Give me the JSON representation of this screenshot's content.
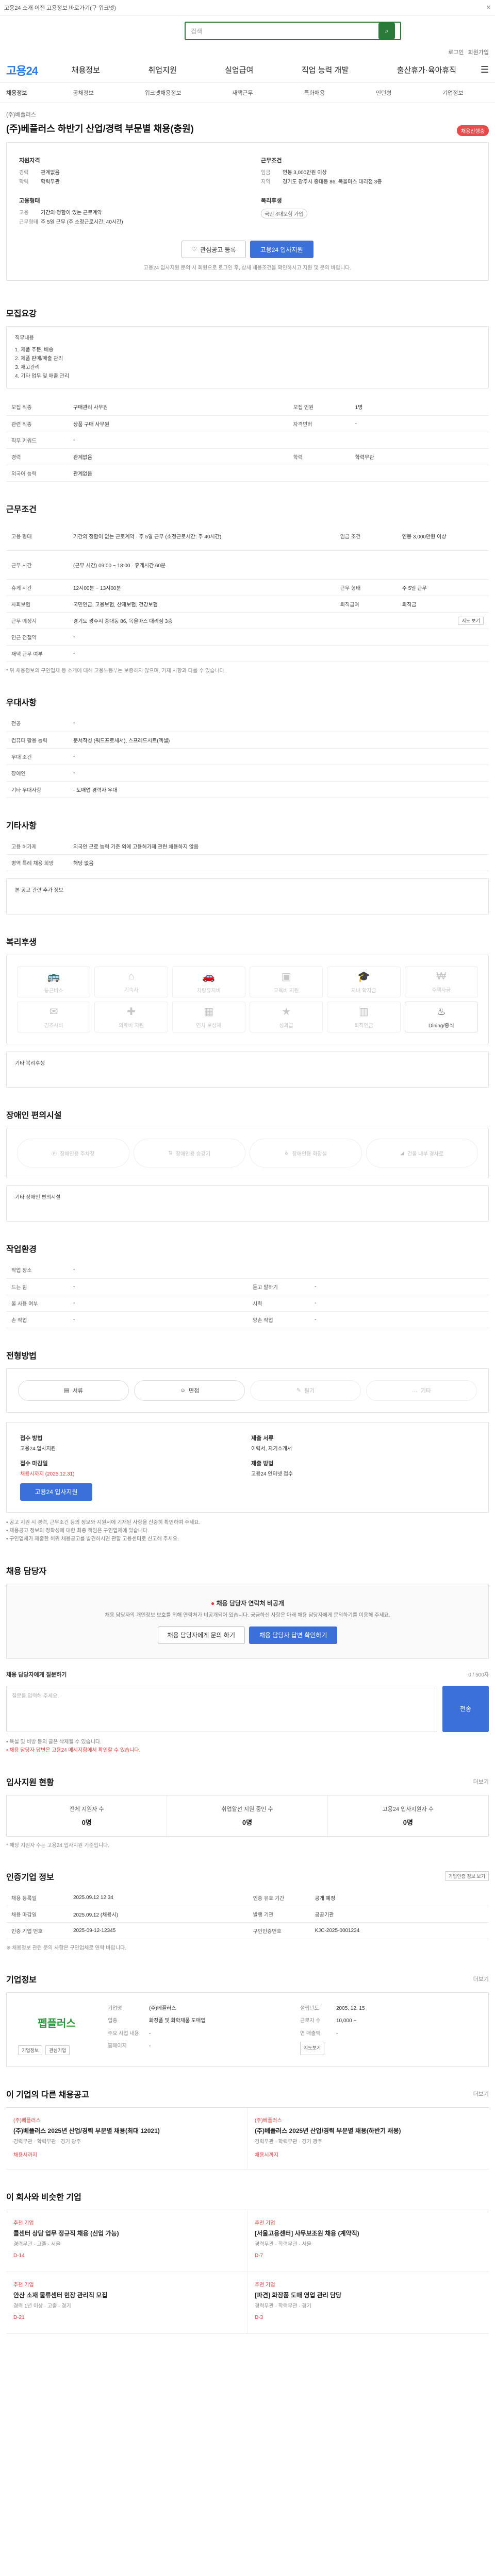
{
  "topbar": {
    "notice": "고용24 소개 이전 고용정보 바로가기(구 워크넷)"
  },
  "search": {
    "placeholder": "검색"
  },
  "util": [
    "로그인",
    "회원가입"
  ],
  "logo": "고용24",
  "gnb": [
    "채용정보",
    "취업지원",
    "실업급여",
    "직업 능력 개발",
    "출산휴가·육아휴직"
  ],
  "subnav": {
    "home": "채용정보",
    "items": [
      "공채정보",
      "워크넷채용정보",
      "재택근무",
      "특화채용",
      "인턴형",
      "기업정보"
    ]
  },
  "job": {
    "company_label": "(주)베플러스",
    "title": "(주)베플러스 하반기 산업/경력 부문별 채용(충원)",
    "badge": "채용진행중",
    "left_head": "지원자격",
    "left": [
      {
        "k": "경력",
        "v": "관계없음"
      },
      {
        "k": "학력",
        "v": "학력무관"
      }
    ],
    "left2_head": "고용형태",
    "left2": [
      {
        "k": "고용",
        "v": "기간의 정함이 있는 근로계약"
      },
      {
        "k": "근무형태",
        "v": "주 5일 근무 (주 소정근로시간: 40시간)"
      }
    ],
    "right_head": "근무조건",
    "right": [
      {
        "k": "임금",
        "v": "연봉 3,000만원 이상"
      },
      {
        "k": "지역",
        "v": "경기도 광주시 중대동 86, 목을마스 대리점 3층"
      }
    ],
    "right2_head": "복리후생",
    "right2_pill": "국민 4대보험 가입",
    "scrap": "관심공고 등록",
    "apply": "고용24 입사지원",
    "apply_note": "고용24 입사지원 문의 시 회원으로 로그인 후, 상세 채용조건을 확인하시고 지원 및 문의 바랍니다."
  },
  "recruit": {
    "title": "모집요강",
    "desc": [
      "직무내용",
      "1. 제품 주문, 배송",
      "2. 제품 판매/매출 관리",
      "3. 재고관리",
      "4. 기타 업무 및 매출 관리"
    ],
    "rows": [
      {
        "k": "모집 직종",
        "v": "구매관리 사무원",
        "k2": "모집 인원",
        "v2": "1명"
      },
      {
        "k": "관련 직종",
        "v": "상품 구매 사무원",
        "k2": "자격면허",
        "v2": "-"
      },
      {
        "k": "직무 키워드",
        "v": "-",
        "k2": "",
        "v2": ""
      },
      {
        "k": "경력",
        "v": "관계없음",
        "k2": "학력",
        "v2": "학력무관"
      },
      {
        "k": "외국어 능력",
        "v": "관계없음",
        "k2": "",
        "v2": ""
      }
    ]
  },
  "condition": {
    "title": "근무조건",
    "rows": [
      {
        "k": "고용 형태",
        "v": "기간의 정함이 없는 근로계약 · 주 5일 근무 (소정근로시간: 주 40시간)",
        "k2": "임금 조건",
        "v2": "연봉 3,000만원 이상"
      },
      {
        "k": "근무 시간",
        "v": "(근무 시간) 09:00 ~ 18:00 · 휴게시간 60분",
        "k2": "",
        "v2": ""
      },
      {
        "k": "휴게 시간",
        "v": "12시00분 ~ 13시00분",
        "k2": "근무 형태",
        "v2": "주 5일 근무"
      },
      {
        "k": "사회보험",
        "v": "국민연금, 고용보험, 산재보험, 건강보험",
        "k2": "퇴직급여",
        "v2": "퇴직금"
      },
      {
        "k": "근무 예정지",
        "v": "경기도 광주시 중대동 86, 목을마스 대리점 3층",
        "k2": "",
        "v2": ""
      },
      {
        "k": "인근 전철역",
        "v": "-",
        "k2": "",
        "v2": ""
      },
      {
        "k": "재택 근무 여부",
        "v": "-",
        "k2": "",
        "v2": ""
      }
    ],
    "map_btn": "지도 보기",
    "note": "* 위 채용정보의 구인업체 등 소개에 대해 고용노동부는 보증하지 않으며, 기재 사항과 다를 수 있습니다."
  },
  "preference": {
    "title": "우대사항",
    "rows": [
      {
        "k": "전공",
        "v": "-"
      },
      {
        "k": "컴퓨터 활용 능력",
        "v": "문서작성 (워드프로세서), 스프레드시트(엑셀)"
      },
      {
        "k": "우대 조건",
        "v": "-"
      },
      {
        "k": "장애인",
        "v": "-"
      },
      {
        "k": "기타 우대사항",
        "v": "· 도매업 경력자 우대"
      }
    ]
  },
  "etc": {
    "title": "기타사항",
    "rows": [
      {
        "k": "고용 허가제",
        "v": "외국인 근로 능력 기준 외에 고용허가제 관련 채용하지 않음"
      },
      {
        "k": "병역 특례 채용 희망",
        "v": "해당 없음"
      }
    ],
    "extra": "본 공고 관련 추가 정보"
  },
  "welfare": {
    "title": "복리후생",
    "icons": [
      {
        "label": "통근버스",
        "on": false,
        "icon": "bus"
      },
      {
        "label": "기숙사",
        "on": false,
        "icon": "home"
      },
      {
        "label": "차량유지비",
        "on": false,
        "icon": "car"
      },
      {
        "label": "교육비 지원",
        "on": false,
        "icon": "book"
      },
      {
        "label": "자녀 학자금",
        "on": false,
        "icon": "grad"
      },
      {
        "label": "주택자금",
        "on": false,
        "icon": "money"
      },
      {
        "label": "경조사비",
        "on": false,
        "icon": "gift"
      },
      {
        "label": "의료비 지원",
        "on": false,
        "icon": "medic"
      },
      {
        "label": "연차 보상제",
        "on": false,
        "icon": "cal"
      },
      {
        "label": "성과급",
        "on": false,
        "icon": "star"
      },
      {
        "label": "퇴직연금",
        "on": false,
        "icon": "safe"
      },
      {
        "label": "Dining/중식",
        "on": true,
        "icon": "meal"
      }
    ],
    "etc": "기타 복리후생"
  },
  "disabled": {
    "title": "장애인 편의시설",
    "items": [
      "장애인용 주차장",
      "장애인용 승강기",
      "장애인용 화장실",
      "건물 내부 경사로"
    ],
    "etc": "기타 장애인 편의시설"
  },
  "env": {
    "title": "작업환경",
    "rows": [
      {
        "k": "작업 장소",
        "v": "-",
        "k2": "",
        "v2": ""
      },
      {
        "k": "드는 힘",
        "v": "-",
        "k2": "듣고 말하기",
        "v2": "-"
      },
      {
        "k": "물 사용 여부",
        "v": "-",
        "k2": "시력",
        "v2": "-"
      },
      {
        "k": "손 작업",
        "v": "-",
        "k2": "양손 작업",
        "v2": "-"
      }
    ]
  },
  "process": {
    "title": "전형방법",
    "steps": [
      {
        "label": "서류",
        "on": true
      },
      {
        "label": "면접",
        "on": true
      },
      {
        "label": "필기",
        "on": false
      },
      {
        "label": "기타",
        "on": false
      }
    ]
  },
  "apply": {
    "method_label": "접수 방법",
    "method": "고용24 입사지원",
    "deadline_label": "접수 마감일",
    "deadline": "채용시까지 (2025.12.31)",
    "docs_label": "제출 서류",
    "docs": "이력서, 자기소개서",
    "prep_label": "제출 방법",
    "prep": "고용24 인터넷 접수",
    "btn": "고용24 입사지원",
    "bullets": [
      "공고 지원 시 경력, 근무조건 등의 정보와 지원서에 기재된 사항을 신중히 확인하여 주세요.",
      "채용공고 정보의 정확성에 대한 최종 책임은 구인업체에 있습니다.",
      "구인업체가 제출한 허위 채용공고를 발견하시면 관할 고용센터로 신고해 주세요."
    ]
  },
  "question": {
    "title": "채용 담당자",
    "alert": "채용 담당자 연락처 비공개",
    "alert_desc": "채용 담당자의 개인정보 보호를 위해 연락처가 비공개되어 있습니다. 궁금하신 사항은 아래 채용 담당자에게 문의하기를 이용해 주세요.",
    "btn1": "채용 담당자에게 문의 하기",
    "btn2": "채용 담당자 답변 확인하기",
    "form_title": "채용 담당자에게 질문하기",
    "placeholder": "질문을 입력해 주세요.",
    "send": "전송",
    "count": "0 / 500자",
    "notes": [
      "욕설 및 비방 등의 글은 삭제될 수 있습니다.",
      "채용 담당자 답변은 고용24 메시지함에서 확인할 수 있습니다."
    ]
  },
  "stats": {
    "title": "입사지원 현황",
    "more": "더보기",
    "cols": [
      {
        "label": "전체 지원자 수",
        "value": "0명"
      },
      {
        "label": "취업알선 지원 중인 수",
        "value": "0명"
      },
      {
        "label": "고용24 입사지원자 수",
        "value": "0명"
      }
    ],
    "note": "* 해당 지원자 수는 고용24 입사지원 기준입니다."
  },
  "ad": {
    "title": "인증기업 정보",
    "btn": "기업인증 정보 보기",
    "rows": [
      {
        "k": "채용 등록일",
        "v": "2025.09.12 12:34",
        "k2": "인증 유효 기간",
        "v2": "공개 예정"
      },
      {
        "k": "채용 마감일",
        "v": "2025.09.12 (채용시)",
        "k2": "발행 기관",
        "v2": "공공기관"
      },
      {
        "k": "인증 기업 번호",
        "v": "2025-09-12-12345",
        "k2": "구인인증번호",
        "v2": "KJC-2025-0001234"
      }
    ],
    "note": "※ 채용정보 관련 문의 사항은 구인업체로 연락 바랍니다."
  },
  "company": {
    "title": "기업정보",
    "more": "더보기",
    "logo_text": "펩플러스",
    "btn1": "기업정보",
    "btn2": "관심기업",
    "rows": [
      {
        "k": "기업명",
        "v": "(주)베플러스",
        "k2": "설립년도",
        "v2": "2005. 12. 15"
      },
      {
        "k": "업종",
        "v": "화장품 및 화학제품 도매업",
        "k2": "근로자 수",
        "v2": "10,000 ~"
      },
      {
        "k": "주요 사업 내용",
        "v": "-",
        "k2": "연 매출액",
        "v2": "-"
      },
      {
        "k": "홈페이지",
        "v": "-",
        "k2": "",
        "v2": ""
      }
    ],
    "map_btn": "지도보기"
  },
  "related": {
    "title": "이 기업의 다른 채용공고",
    "more": "더보기",
    "cards": [
      {
        "co": "(주)베플러스",
        "title": "(주)베플러스 2025년 산업/경력 부문별 채용(최대 12021)",
        "meta": "경력무관 · 학력무관 · 경기 광주",
        "dday": "채용시까지"
      },
      {
        "co": "(주)베플러스",
        "title": "(주)베플러스 2025년 산업/경력 부문별 채용(하반기 채용)",
        "meta": "경력무관 · 학력무관 · 경기 광주",
        "dday": "채용시까지"
      }
    ]
  },
  "recommend": {
    "title": "이 회사와 비슷한 기업",
    "cards": [
      {
        "co": "추천 기업",
        "title": "콜센터 상담 업무 정규직 채용 (신입 가능)",
        "meta": "경력무관 · 고졸 · 서울",
        "dday": "D-14"
      },
      {
        "co": "추천 기업",
        "title": "[서울고용센터] 사무보조원 채용 (계약직)",
        "meta": "경력무관 · 학력무관 · 서울",
        "dday": "D-7"
      },
      {
        "co": "추천 기업",
        "title": "안산 소재 물류센터 현장 관리직 모집",
        "meta": "경력 1년 이상 · 고졸 · 경기",
        "dday": "D-21"
      },
      {
        "co": "추천 기업",
        "title": "[파견] 화장품 도매 영업 관리 담당",
        "meta": "경력무관 · 학력무관 · 경기",
        "dday": "D-3"
      }
    ]
  }
}
